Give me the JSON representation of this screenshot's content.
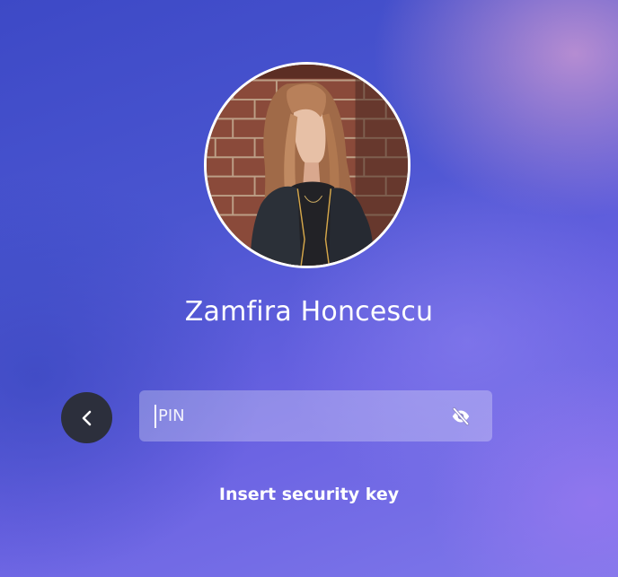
{
  "user": {
    "name": "Zamfira Honcescu",
    "avatar": "profile-photo"
  },
  "signin": {
    "back_icon": "chevron-left-icon",
    "pin_placeholder": "PIN",
    "pin_value": "",
    "reveal_icon": "eye-off-icon",
    "alt_option_label": "Insert security key"
  },
  "colors": {
    "background_primary": "#4a55d0",
    "background_accent": "#c896d2",
    "back_button": "#2c2f3c",
    "text": "#ffffff"
  }
}
